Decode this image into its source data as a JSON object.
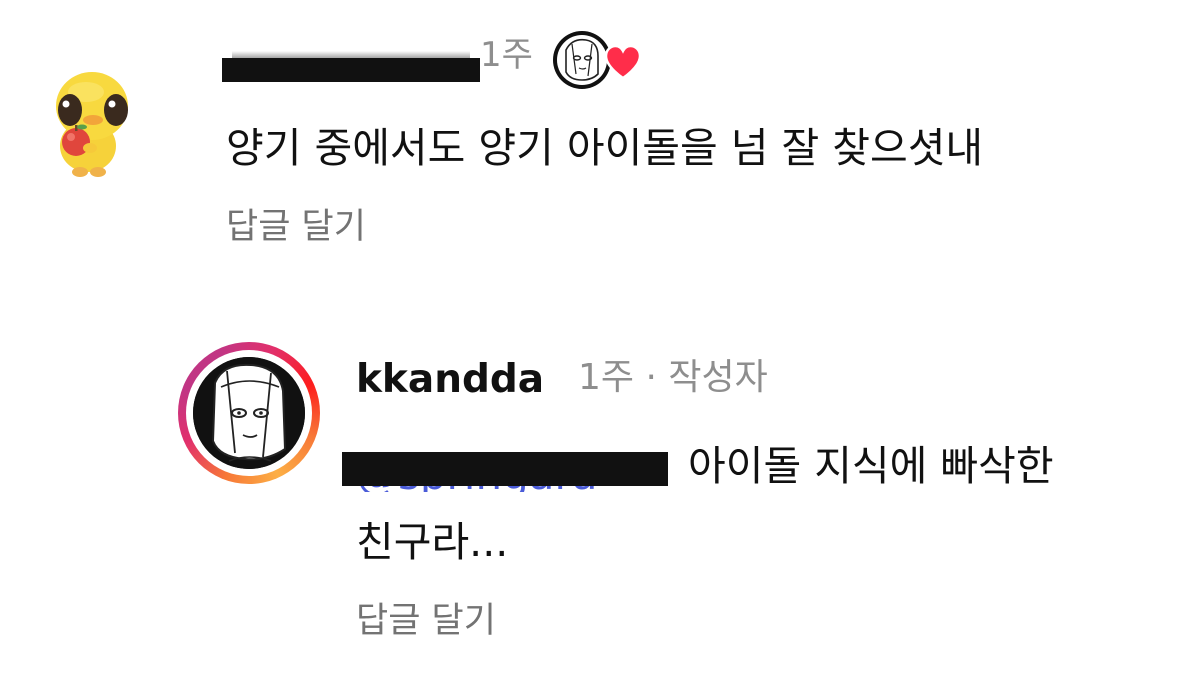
{
  "comments": [
    {
      "avatar_icon": "yellow-duck-apple-avatar-icon",
      "username_redacted": true,
      "time": "1주",
      "liked_by_author": true,
      "heart_color": "#ff2d4a",
      "text": "양기 중에서도 양기 아이돌을 넘 잘 찾으셧내",
      "reply_label": "답글 달기"
    },
    {
      "avatar_icon": "sketch-face-avatar-icon",
      "username": "kkandda",
      "meta": "1주 · 작성자",
      "mention": "@springara",
      "mention_redacted": true,
      "text_line1": "아이돌 지식에 빠삭한",
      "text_line2": "친구라...",
      "reply_label": "답글 달기"
    }
  ],
  "colors": {
    "meta_gray": "#8e8e8e",
    "reply_gray": "#737373",
    "mention_blue": "#4a5bd8",
    "redaction": "#111111"
  }
}
